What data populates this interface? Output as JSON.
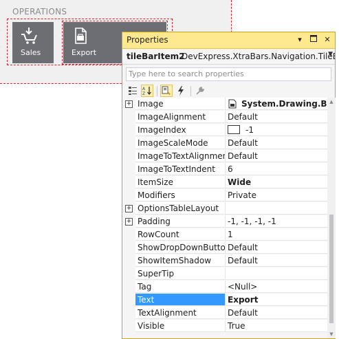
{
  "designer": {
    "group_label": "OPERATIONS",
    "tiles": [
      {
        "label": "Sales",
        "icon": "cart-download-icon"
      },
      {
        "label": "Export",
        "icon": "document-export-icon"
      }
    ]
  },
  "properties_window": {
    "title": "Properties",
    "buttons": [
      "pin-dropdown",
      "maximize",
      "close"
    ],
    "object_name": "tileBarItem2",
    "object_type": "DevExpress.XtraBars.Navigation.TileBarIt",
    "search_placeholder": "Type here to search properties",
    "toolbar": [
      "categorized-icon",
      "alphabetical-icon",
      "properties-icon",
      "events-icon",
      "property-pages-icon"
    ],
    "rows": [
      {
        "name": "Image",
        "value": "System.Drawing.Bitm",
        "bold": true,
        "expandable": true,
        "kind": "image"
      },
      {
        "name": "ImageAlignment",
        "value": "Default"
      },
      {
        "name": "ImageIndex",
        "value": "-1",
        "kind": "swatch"
      },
      {
        "name": "ImageScaleMode",
        "value": "Default"
      },
      {
        "name": "ImageToTextAlignment",
        "value": "Default"
      },
      {
        "name": "ImageToTextIndent",
        "value": "6"
      },
      {
        "name": "ItemSize",
        "value": "Wide",
        "bold": true
      },
      {
        "name": "Modifiers",
        "value": "Private"
      },
      {
        "name": "OptionsTableLayout",
        "value": "",
        "expandable": true
      },
      {
        "name": "Padding",
        "value": "-1, -1, -1, -1",
        "expandable": true
      },
      {
        "name": "RowCount",
        "value": "1"
      },
      {
        "name": "ShowDropDownButton",
        "value": "Default"
      },
      {
        "name": "ShowItemShadow",
        "value": "Default"
      },
      {
        "name": "SuperTip",
        "value": ""
      },
      {
        "name": "Tag",
        "value": "<Null>"
      },
      {
        "name": "Text",
        "value": "Export",
        "bold": true,
        "selected": true
      },
      {
        "name": "TextAlignment",
        "value": "Default"
      },
      {
        "name": "Visible",
        "value": "True"
      }
    ]
  },
  "colors": {
    "title_bar": "#ffe98f",
    "tile": "#6d6d74",
    "selection": "#3399ff",
    "designer_border": "#e0202a"
  }
}
